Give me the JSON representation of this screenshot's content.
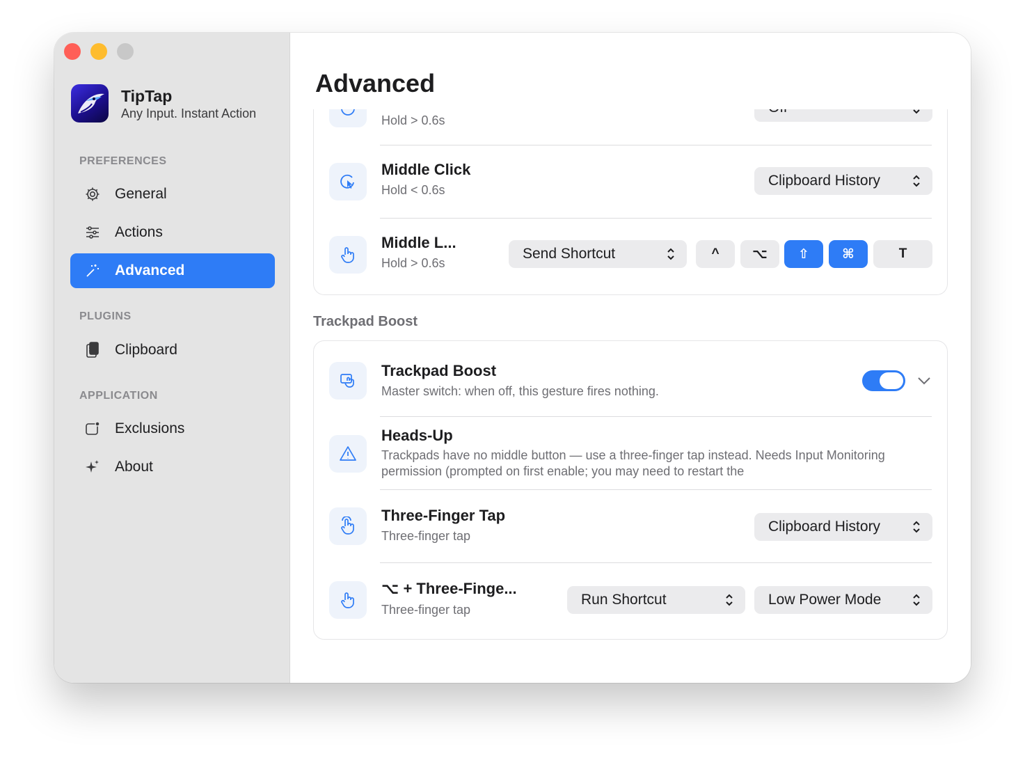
{
  "app": {
    "name": "TipTap",
    "tagline": "Any Input. Instant Action"
  },
  "sidebar": {
    "sections": [
      {
        "label": "PREFERENCES"
      },
      {
        "label": "PLUGINS"
      },
      {
        "label": "APPLICATION"
      }
    ],
    "items": [
      {
        "label": "General",
        "icon": "gear-icon"
      },
      {
        "label": "Actions",
        "icon": "sliders-icon"
      },
      {
        "label": "Advanced",
        "icon": "magic-wand-icon",
        "active": true
      },
      {
        "label": "Clipboard",
        "icon": "clipboard-icon"
      },
      {
        "label": "Exclusions",
        "icon": "window-badge-icon"
      },
      {
        "label": "About",
        "icon": "sparkles-icon"
      }
    ]
  },
  "page": {
    "title": "Advanced"
  },
  "mouse_rows": {
    "partial": {
      "sub": "Hold > 0.6s",
      "select": "Off"
    },
    "middle_click": {
      "title": "Middle Click",
      "sub": "Hold < 0.6s",
      "select": "Clipboard History"
    },
    "middle_long": {
      "title": "Middle L...",
      "sub": "Hold > 0.6s",
      "select": "Send Shortcut",
      "keys": [
        {
          "label": "^",
          "active": false
        },
        {
          "label": "⌥",
          "active": false
        },
        {
          "label": "⇧",
          "active": true
        },
        {
          "label": "⌘",
          "active": true
        },
        {
          "label": "T",
          "active": false
        }
      ]
    }
  },
  "trackpad": {
    "section_title": "Trackpad Boost",
    "boost": {
      "title": "Trackpad Boost",
      "sub": "Master switch: when off, this gesture fires nothing.",
      "enabled": true
    },
    "heads_up": {
      "title": "Heads-Up",
      "sub": "Trackpads have no middle button — use a three-finger tap instead. Needs Input Monitoring permission (prompted on first enable; you may need to restart the"
    },
    "three_finger": {
      "title": "Three-Finger Tap",
      "sub": "Three-finger tap",
      "select": "Clipboard History"
    },
    "option_three_finger": {
      "title": "⌥ + Three-Finge...",
      "sub": "Three-finger tap",
      "select_action": "Run Shortcut",
      "select_shortcut": "Low Power Mode"
    }
  },
  "colors": {
    "accent": "#2e7cf6",
    "sidebar_bg": "#e4e4e4",
    "close": "#ff5f57",
    "minimize": "#febc2e",
    "zoom": "#c8c8c8"
  }
}
